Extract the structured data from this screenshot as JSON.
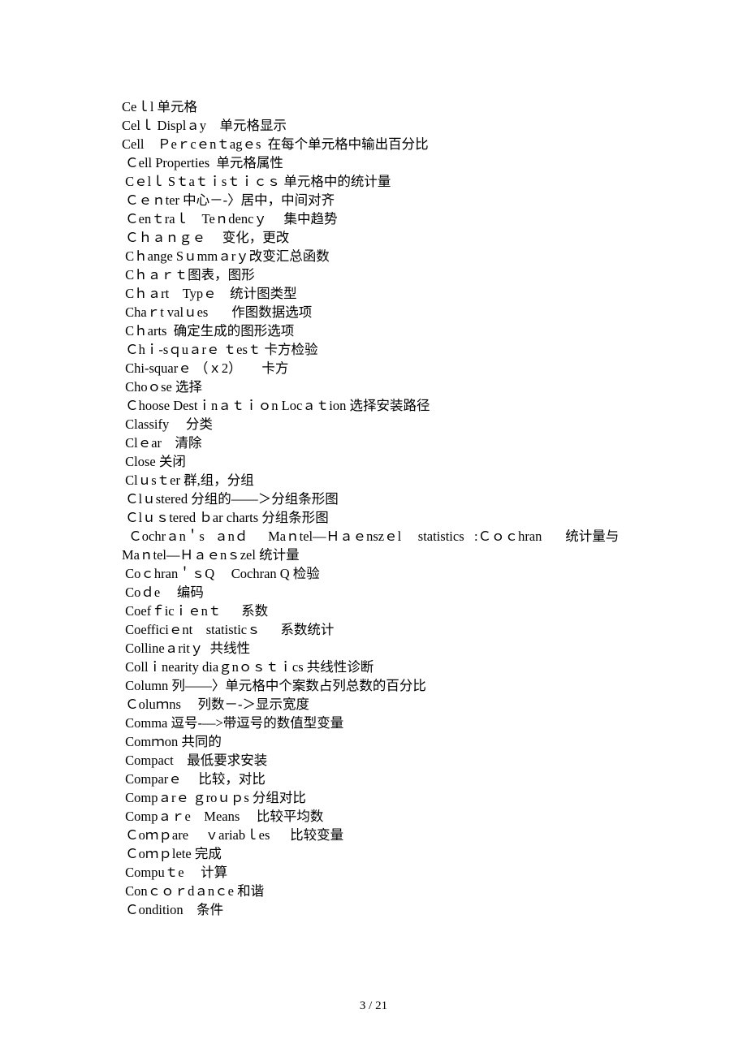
{
  "entries": [
    "Ceｌl 单元格",
    "Celｌ Displａy　单元格显示",
    "Cell　Ｐeｒcｅnｔagｅs  在每个单元格中输出百分比",
    " Ｃell Properties  单元格属性",
    " Cｅlｌ Sｔaｔｉsｔｉｃｓ 单元格中的统计量",
    " Ｃｅｎter 中心－-〉居中，中间对齐",
    " Ｃenｔraｌ　Teｎdencｙ　 集中趋势",
    " Ｃｈａｎｇｅ　 变化，更改",
    " Cｈange Sｕmmａrｙ改变汇总函数",
    " Cｈａｒｔ图表，图形",
    " Cｈａrt　Typｅ    统计图类型",
    " Chaｒt valｕes　   作图数据选项",
    " Cｈarts  确定生成的图形选项",
    " Ｃhｉ-sｑuａrｅ ｔesｔ 卡方检验",
    " Chi-squarｅ （ｘ2）　    卡方",
    " Choｏse 选择",
    " Ｃhoose Destｉnａｔｉｏn Locａｔion 选择安装路径",
    " Classify　 分类",
    " Clｅar　清除",
    " Close 关闭",
    " Clｕsｔer 群,组，分组",
    " Ｃlｕstered 分组的——＞分组条形图",
    " Ｃlｕｓtered ｂar charts 分组条形图",
    "  Ｃochrａn＇s   ａnｄ      Maｎtel—Ｈａｅnszｅl     statistics   :Ｃｏｃhran       统计量与Maｎtel—Ｈａｅnｓzel 统计量",
    " Coｃhran＇ｓQ　 Cochran Q 检验",
    " Coｄe　 编码",
    " Coefｆicｉｅnｔ　  系数",
    " Coefficiｅnt    statisticｓ      系数统计",
    " Collineａritｙ  共线性",
    " Collｉnearity diaｇnｏｓｔｉcs 共线性诊断",
    " Column 列——〉单元格中个案数占列总数的百分比",
    " Ｃoluｍns　 列数－-＞显示宽度",
    " Comma 逗号-—>带逗号的数值型变量",
    " Comｍon 共同的",
    " Compact    最低要求安装",
    " Comparｅ     比较，对比",
    " Compａrｅ ｇroｕｐs 分组对比",
    " Compａｒe　Means　 比较平均数",
    " Ｃoｍｐare 　ｖariabｌes      比较变量",
    " Ｃoｍｐlete 完成",
    " Compuｔe　 计算",
    " Conｃｏｒdａnｃe 和谐",
    " Ｃondition    条件"
  ],
  "footer": "3 / 21"
}
